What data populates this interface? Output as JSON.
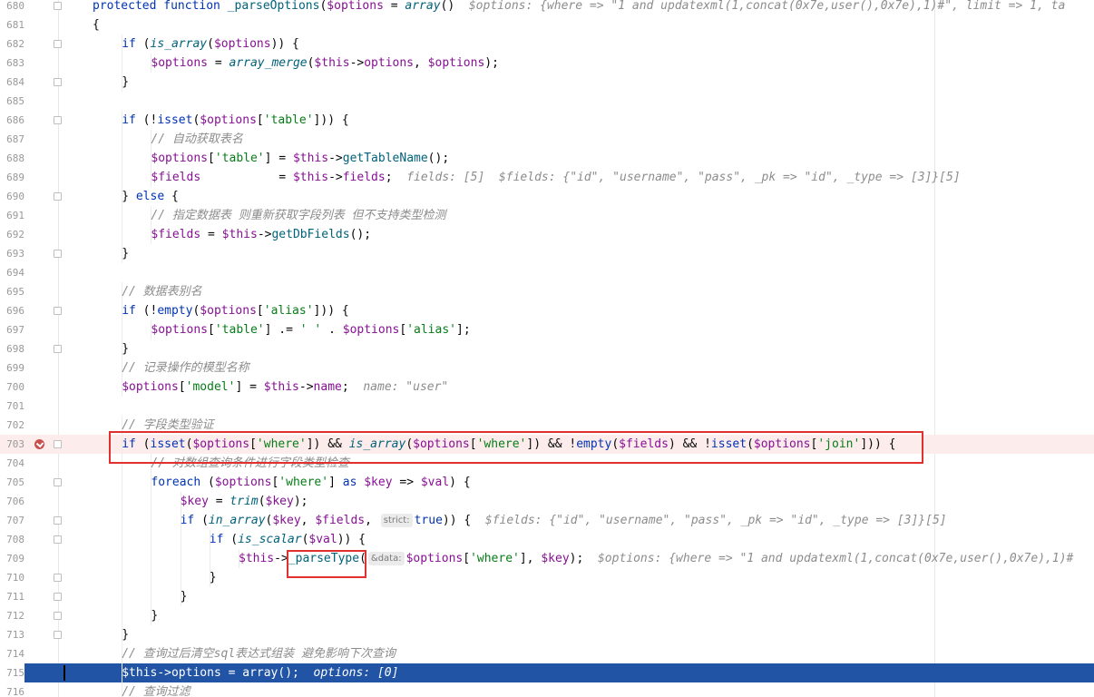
{
  "line_numbers": [
    "680",
    "681",
    "682",
    "683",
    "684",
    "685",
    "686",
    "687",
    "688",
    "689",
    "690",
    "691",
    "692",
    "693",
    "694",
    "695",
    "696",
    "697",
    "698",
    "699",
    "700",
    "701",
    "702",
    "703",
    "704",
    "705",
    "706",
    "707",
    "708",
    "709",
    "710",
    "711",
    "712",
    "713",
    "714",
    "715",
    "716"
  ],
  "lines": {
    "l680": {
      "kw": "protected function ",
      "fn": "_parseOptions",
      "a": "(",
      "v": "$options",
      " b": " = ",
      "arr": "array",
      "c": "()",
      "hint": "$options: {where => \"1 and updatexml(1,concat(0x7e,user(),0x7e),1)#\", limit => 1, ta"
    },
    "l681": {
      "t": "{"
    },
    "l682": {
      "kw": "if ",
      "a": "(",
      "fn": "is_array",
      "b": "(",
      "v": "$options",
      "c": ")) {"
    },
    "l683": {
      "v1": "$options",
      "a": " = ",
      "fn": "array_merge",
      "b": "(",
      "v2": "$this",
      "c": "->",
      "p": "options",
      "d": ", ",
      "v3": "$options",
      "e": ");"
    },
    "l684": {
      "t": "}"
    },
    "l686": {
      "kw": "if ",
      "a": "(!",
      "fn": "isset",
      "b": "(",
      "v": "$options",
      "c": "[",
      "s": "'table'",
      "d": "])) {"
    },
    "l687": {
      "c": "// 自动获取表名"
    },
    "l688": {
      "v1": "$options",
      "a": "[",
      "s": "'table'",
      "b": "] = ",
      "v2": "$this",
      "c": "->",
      "fn": "getTableName",
      "d": "();"
    },
    "l689": {
      "v1": "$fields",
      "a": "           = ",
      "v2": "$this",
      "c": "->",
      "p": "fields",
      "d": ";",
      "hint": "fields: [5]  $fields: {\"id\", \"username\", \"pass\", _pk => \"id\", _type => [3]}[5]"
    },
    "l690": {
      "a": "} ",
      "kw": "else",
      "b": " {"
    },
    "l691": {
      "c": "// 指定数据表 则重新获取字段列表 但不支持类型检测"
    },
    "l692": {
      "v1": "$fields",
      "a": " = ",
      "v2": "$this",
      "c": "->",
      "fn": "getDbFields",
      "d": "();"
    },
    "l693": {
      "t": "}"
    },
    "l695": {
      "c": "// 数据表别名"
    },
    "l696": {
      "kw": "if ",
      "a": "(!",
      "fn": "empty",
      "b": "(",
      "v": "$options",
      "c": "[",
      "s": "'alias'",
      "d": "])) {"
    },
    "l697": {
      "v1": "$options",
      "a": "[",
      "s1": "'table'",
      "b": "] .= ",
      "s2": "' '",
      "c": " . ",
      "v2": "$options",
      "d": "[",
      "s3": "'alias'",
      "e": "];"
    },
    "l698": {
      "t": "}"
    },
    "l699": {
      "c": "// 记录操作的模型名称"
    },
    "l700": {
      "v1": "$options",
      "a": "[",
      "s": "'model'",
      "b": "] = ",
      "v2": "$this",
      "c": "->",
      "p": "name",
      "d": ";",
      "hint": "name: \"user\""
    },
    "l702": {
      "c": "// 字段类型验证"
    },
    "l703": {
      "kw": "if ",
      "a": "(",
      "fn1": "isset",
      "b": "(",
      "v1": "$options",
      "c": "[",
      "s1": "'where'",
      "d": "]) && ",
      "fn2": "is_array",
      "e": "(",
      "v2": "$options",
      "f": "[",
      "s2": "'where'",
      "g": "]) && !",
      "fn3": "empty",
      "h": "(",
      "v3": "$fields",
      "i": ") && !",
      "fn4": "isset",
      "j": "(",
      "v4": "$options",
      "k": "[",
      "s3": "'join'",
      "l": "])) {"
    },
    "l704": {
      "c": "// 对数组查询条件进行字段类型检查"
    },
    "l705": {
      "kw": "foreach ",
      "a": "(",
      "v1": "$options",
      "b": "[",
      "s": "'where'",
      "c": "] ",
      "kw2": "as ",
      "v2": "$key",
      "d": " => ",
      "v3": "$val",
      "e": ") {"
    },
    "l706": {
      "v1": "$key",
      "a": " = ",
      "fn": "trim",
      "b": "(",
      "v2": "$key",
      "c": ");"
    },
    "l707": {
      "kw": "if ",
      "a": "(",
      "fn": "in_array",
      "b": "(",
      "v1": "$key",
      "c": ", ",
      "v2": "$fields",
      "d": ", ",
      "param": "strict:",
      "kw2": "true",
      "e": ")) {",
      "hint": "$fields: {\"id\", \"username\", \"pass\", _pk => \"id\", _type => [3]}[5]"
    },
    "l708": {
      "kw": "if ",
      "a": "(",
      "fn": "is_scalar",
      "b": "(",
      "v": "$val",
      "c": ")) {"
    },
    "l709": {
      "v1": "$this",
      "a": "->",
      "fn": "_parseType",
      "b": "(",
      "param": "&data:",
      "v2": "$options",
      "c": "[",
      "s": "'where'",
      "d": "], ",
      "v3": "$key",
      "e": ");",
      "hint": "$options: {where => \"1 and updatexml(1,concat(0x7e,user(),0x7e),1)#"
    },
    "l710": {
      "t": "}"
    },
    "l711": {
      "t": "}"
    },
    "l712": {
      "t": "}"
    },
    "l713": {
      "t": "}"
    },
    "l714": {
      "c": "// 查询过后清空sql表达式组装 避免影响下次查询"
    },
    "l715": {
      "v1": "$this",
      "a": "->options = ",
      "fn": "array",
      "b": "();",
      "hint": "options: [0]"
    },
    "l716": {
      "c": "// 查询过滤"
    }
  }
}
